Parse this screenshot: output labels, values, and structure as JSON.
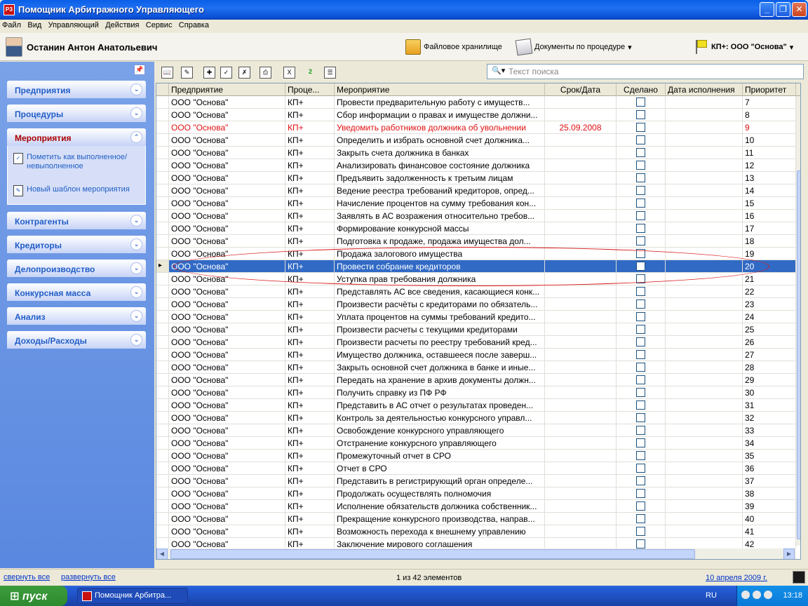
{
  "window": {
    "title": "Помощник Арбитражного Управляющего",
    "icon": "app-icon",
    "minimize": "_",
    "maximize": "❐",
    "close": "✕"
  },
  "menu": [
    "Файл",
    "Вид",
    "Управляющий",
    "Действия",
    "Сервис",
    "Справка"
  ],
  "user": {
    "name": "Останин Антон Анатольевич"
  },
  "toolbar_top": {
    "file_storage": "Файловое хранилище",
    "documents": "Документы по процедуре",
    "procedure": "КП+: ООО \"Основа\""
  },
  "nav": {
    "groups": [
      "Предприятия",
      "Процедуры",
      "Мероприятия",
      "Контрагенты",
      "Кредиторы",
      "Делопроизводство",
      "Конкурсная масса",
      "Анализ",
      "Доходы/Расходы"
    ],
    "events_links": [
      "Пометить как выполненное/невыполненное",
      "Новый шаблон мероприятия"
    ]
  },
  "search": {
    "placeholder": "Текст поиска"
  },
  "grid": {
    "columns": [
      "Предприятие",
      "Проце...",
      "Мероприятие",
      "Срок/Дата",
      "Сделано",
      "Дата исполнения",
      "Приоритет"
    ],
    "rows": [
      {
        "c1": "ООО \"Основа\"",
        "c2": "КП+",
        "c3": "Провести предварительную работу с имуществ...",
        "c4": "",
        "p": "7"
      },
      {
        "c1": "ООО \"Основа\"",
        "c2": "КП+",
        "c3": "Сбор информации о правах и имуществе должни...",
        "c4": "",
        "p": "8"
      },
      {
        "c1": "ООО \"Основа\"",
        "c2": "КП+",
        "c3": "Уведомить работников должника об увольнении",
        "c4": "25.09.2008",
        "p": "9",
        "red": true
      },
      {
        "c1": "ООО \"Основа\"",
        "c2": "КП+",
        "c3": "Определить и избрать основной счет должника...",
        "c4": "",
        "p": "10"
      },
      {
        "c1": "ООО \"Основа\"",
        "c2": "КП+",
        "c3": "Закрыть счета должника в банках",
        "c4": "",
        "p": "11"
      },
      {
        "c1": "ООО \"Основа\"",
        "c2": "КП+",
        "c3": "Анализировать финансовое состояние должника",
        "c4": "",
        "p": "12"
      },
      {
        "c1": "ООО \"Основа\"",
        "c2": "КП+",
        "c3": "Предъявить задолженность к третьим лицам",
        "c4": "",
        "p": "13"
      },
      {
        "c1": "ООО \"Основа\"",
        "c2": "КП+",
        "c3": "Ведение реестра требований кредиторов, опред...",
        "c4": "",
        "p": "14"
      },
      {
        "c1": "ООО \"Основа\"",
        "c2": "КП+",
        "c3": "Начисление процентов на сумму требования кон...",
        "c4": "",
        "p": "15"
      },
      {
        "c1": "ООО \"Основа\"",
        "c2": "КП+",
        "c3": "Заявлять в АС возражения относительно требов...",
        "c4": "",
        "p": "16"
      },
      {
        "c1": "ООО \"Основа\"",
        "c2": "КП+",
        "c3": "Формирование конкурсной массы",
        "c4": "",
        "p": "17"
      },
      {
        "c1": "ООО \"Основа\"",
        "c2": "КП+",
        "c3": "Подготовка к продаже, продажа имущества дол...",
        "c4": "",
        "p": "18"
      },
      {
        "c1": "ООО \"Основа\"",
        "c2": "КП+",
        "c3": "Продажа залогового имущества",
        "c4": "",
        "p": "19"
      },
      {
        "c1": "ООО \"Основа\"",
        "c2": "КП+",
        "c3": "Провести собрание кредиторов",
        "c4": "",
        "p": "20",
        "selected": true
      },
      {
        "c1": "ООО \"Основа\"",
        "c2": "КП+",
        "c3": "Уступка прав требования должника",
        "c4": "",
        "p": "21"
      },
      {
        "c1": "ООО \"Основа\"",
        "c2": "КП+",
        "c3": "Представлять АС все сведения, касающиеся конк...",
        "c4": "",
        "p": "22"
      },
      {
        "c1": "ООО \"Основа\"",
        "c2": "КП+",
        "c3": "Произвести расчёты с кредиторами по обязатель...",
        "c4": "",
        "p": "23"
      },
      {
        "c1": "ООО \"Основа\"",
        "c2": "КП+",
        "c3": "Уплата процентов на суммы требований кредито...",
        "c4": "",
        "p": "24"
      },
      {
        "c1": "ООО \"Основа\"",
        "c2": "КП+",
        "c3": "Произвести расчеты с текущими кредиторами",
        "c4": "",
        "p": "25"
      },
      {
        "c1": "ООО \"Основа\"",
        "c2": "КП+",
        "c3": "Произвести расчеты по реестру требований кред...",
        "c4": "",
        "p": "26"
      },
      {
        "c1": "ООО \"Основа\"",
        "c2": "КП+",
        "c3": "Имущество должника, оставшееся после заверш...",
        "c4": "",
        "p": "27"
      },
      {
        "c1": "ООО \"Основа\"",
        "c2": "КП+",
        "c3": "Закрыть основной счет должника в банке и иные...",
        "c4": "",
        "p": "28"
      },
      {
        "c1": "ООО \"Основа\"",
        "c2": "КП+",
        "c3": "Передать на хранение в архив документы должн...",
        "c4": "",
        "p": "29"
      },
      {
        "c1": "ООО \"Основа\"",
        "c2": "КП+",
        "c3": "Получить справку из ПФ РФ",
        "c4": "",
        "p": "30"
      },
      {
        "c1": "ООО \"Основа\"",
        "c2": "КП+",
        "c3": "Представить в АС отчет о результатах проведен...",
        "c4": "",
        "p": "31"
      },
      {
        "c1": "ООО \"Основа\"",
        "c2": "КП+",
        "c3": "Контроль за деятельностью конкурсного управл...",
        "c4": "",
        "p": "32"
      },
      {
        "c1": "ООО \"Основа\"",
        "c2": "КП+",
        "c3": "Освобождение конкурсного управляющего",
        "c4": "",
        "p": "33"
      },
      {
        "c1": "ООО \"Основа\"",
        "c2": "КП+",
        "c3": "Отстранение конкурсного управляющего",
        "c4": "",
        "p": "34"
      },
      {
        "c1": "ООО \"Основа\"",
        "c2": "КП+",
        "c3": "Промежуточный отчет в СРО",
        "c4": "",
        "p": "35"
      },
      {
        "c1": "ООО \"Основа\"",
        "c2": "КП+",
        "c3": "Отчет в СРО",
        "c4": "",
        "p": "36"
      },
      {
        "c1": "ООО \"Основа\"",
        "c2": "КП+",
        "c3": "Представить в регистрирующий орган определе...",
        "c4": "",
        "p": "37"
      },
      {
        "c1": "ООО \"Основа\"",
        "c2": "КП+",
        "c3": "Продолжать осуществлять полномочия",
        "c4": "",
        "p": "38"
      },
      {
        "c1": "ООО \"Основа\"",
        "c2": "КП+",
        "c3": "Исполнение обязательств должника собственник...",
        "c4": "",
        "p": "39"
      },
      {
        "c1": "ООО \"Основа\"",
        "c2": "КП+",
        "c3": "Прекращение конкурсного производства, направ...",
        "c4": "",
        "p": "40"
      },
      {
        "c1": "ООО \"Основа\"",
        "c2": "КП+",
        "c3": "Возможность перехода к внешнему управлению",
        "c4": "",
        "p": "41"
      },
      {
        "c1": "ООО \"Основа\"",
        "c2": "КП+",
        "c3": "Заключение мирового соглашения",
        "c4": "",
        "p": "42"
      }
    ]
  },
  "status": {
    "collapse_all": "свернуть все",
    "expand_all": "развернуть все",
    "count": "1 из 42 элементов",
    "date": "10 апреля 2009 г."
  },
  "taskbar": {
    "start": "пуск",
    "task": "Помощник Арбитра...",
    "lang": "RU",
    "clock": "13:18"
  }
}
